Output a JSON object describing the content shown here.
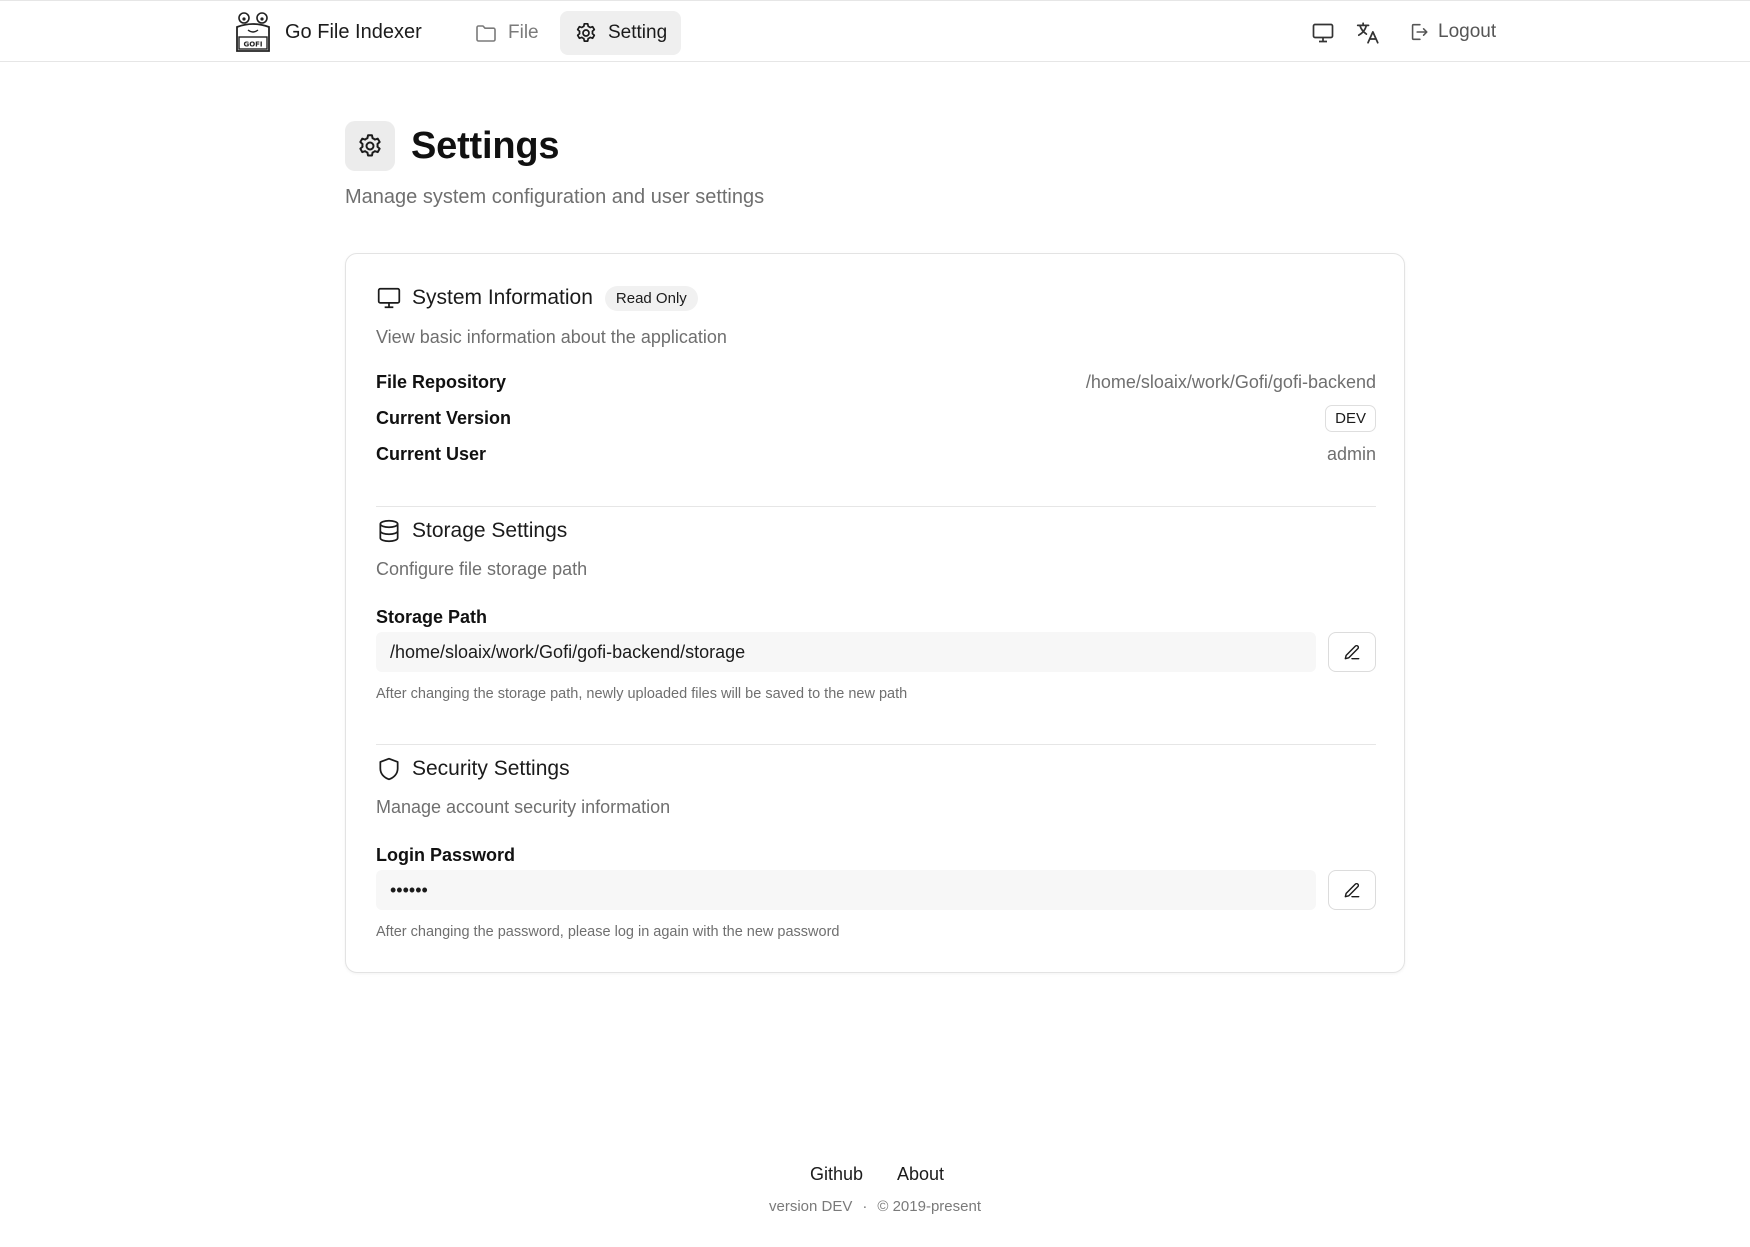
{
  "header": {
    "app_name": "Go File Indexer",
    "logo_text": "GOFI",
    "nav": [
      {
        "label": "File",
        "icon": "folder-icon",
        "active": false
      },
      {
        "label": "Setting",
        "icon": "gear-icon",
        "active": true
      }
    ],
    "logout_label": "Logout"
  },
  "page": {
    "title": "Settings",
    "subtitle": "Manage system configuration and user settings"
  },
  "system_info": {
    "title": "System Information",
    "badge": "Read Only",
    "description": "View basic information about the application",
    "rows": [
      {
        "label": "File Repository",
        "value": "/home/sloaix/work/Gofi/gofi-backend"
      },
      {
        "label": "Current Version",
        "value": "DEV"
      },
      {
        "label": "Current User",
        "value": "admin"
      }
    ]
  },
  "storage": {
    "title": "Storage Settings",
    "description": "Configure file storage path",
    "field_label": "Storage Path",
    "field_value": "/home/sloaix/work/Gofi/gofi-backend/storage",
    "hint": "After changing the storage path, newly uploaded files will be saved to the new path"
  },
  "security": {
    "title": "Security Settings",
    "description": "Manage account security information",
    "field_label": "Login Password",
    "field_value": "••••••",
    "hint": "After changing the password, please log in again with the new password"
  },
  "footer": {
    "links": [
      "Github",
      "About"
    ],
    "version": "version DEV",
    "separator": "·",
    "copyright": "© 2019-present"
  },
  "colors": {
    "active_nav_bg": "#efefef",
    "muted_text": "#6f6f6f",
    "border": "#e3e3e3"
  }
}
